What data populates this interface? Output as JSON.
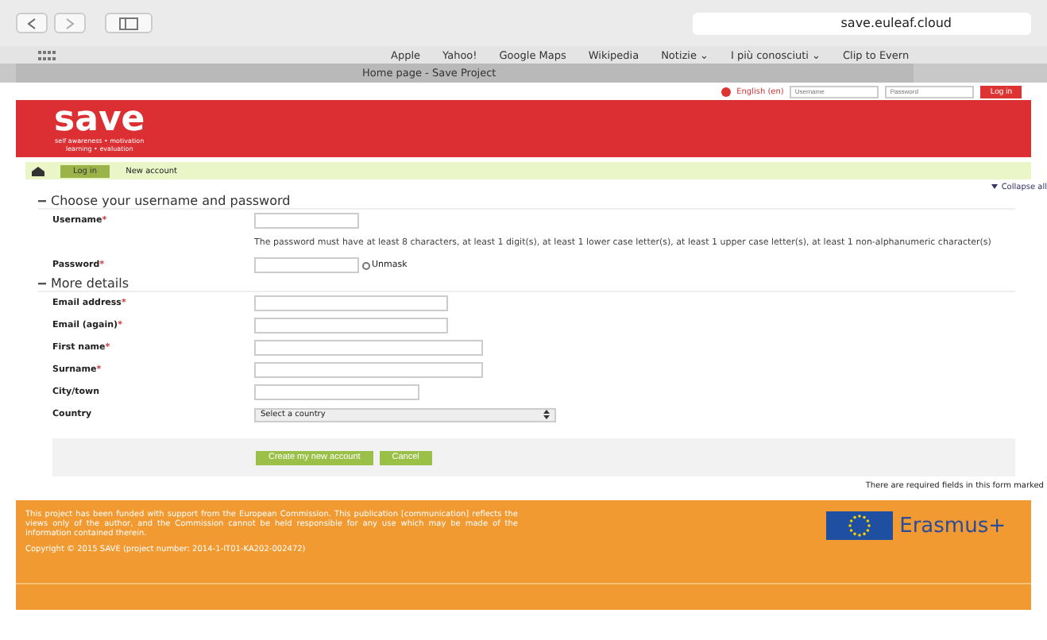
{
  "browser": {
    "url": "save.euleaf.cloud",
    "bookmarks": [
      "Apple",
      "Yahoo!",
      "Google Maps",
      "Wikipedia",
      "Notizie ⌄",
      "I più conosciuti ⌄",
      "Clip to Evern"
    ],
    "tab_title": "Home page - Save Project"
  },
  "login_bar": {
    "language": "English (en)",
    "username_placeholder": "Username",
    "password_placeholder": "Password",
    "login_button": "Log in"
  },
  "header": {
    "logo": "save",
    "tagline": [
      "self awareness • motivation",
      "learning • evaluation"
    ]
  },
  "breadcrumb": [
    "Log in",
    "New account"
  ],
  "collapse_link": "Collapse all",
  "sections": [
    {
      "title": "Choose your username and password",
      "fields": [
        {
          "label": "Username",
          "required_mark": "*",
          "kind": "text"
        },
        {
          "kind": "note",
          "text": "The password must have at least 8 characters, at least 1 digit(s), at least 1 lower case letter(s), at least 1 upper case letter(s), at least 1 non-alphanumeric character(s)"
        },
        {
          "label": "Password",
          "required_mark": "*",
          "kind": "password",
          "unmask_label": "Unmask",
          "unmask_checked": false
        }
      ]
    },
    {
      "title": "More details",
      "fields": [
        {
          "label": "Email address",
          "required_mark": "*",
          "kind": "text"
        },
        {
          "label": "Email (again)",
          "required_mark": "*",
          "kind": "text"
        },
        {
          "label": "First name",
          "required_mark": "*",
          "kind": "text"
        },
        {
          "label": "Surname",
          "required_mark": "*",
          "kind": "text"
        },
        {
          "label": "City/town",
          "kind": "text"
        },
        {
          "label": "Country",
          "kind": "select",
          "value": "Select a country"
        }
      ]
    }
  ],
  "buttons": [
    "Create my new account",
    "Cancel"
  ],
  "required_note": "There are required fields in this form marked",
  "footer": {
    "text": "This project has been funded with support from the European Commission. This publication [communication] reflects the views only of the author, and the Commission cannot be held responsible for any use which may be made of the information contained therein.",
    "copyright": "Copyright © 2015 SAVE (project number: 2014-1-IT01-KA202-002472)",
    "logo_text": "Erasmus+"
  }
}
